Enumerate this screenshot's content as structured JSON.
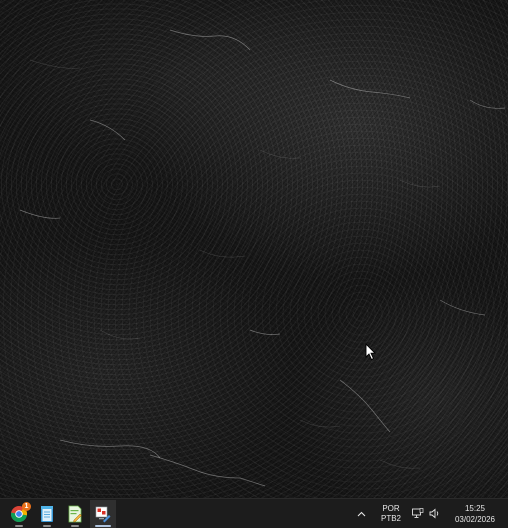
{
  "desktop": {
    "wallpaper": "dark-stone-texture",
    "cursor_icon": "arrow-cursor-icon"
  },
  "taskbar": {
    "apps": [
      {
        "icon": "chrome-icon",
        "badge": "1",
        "active": false
      },
      {
        "icon": "notepad-icon",
        "active": false
      },
      {
        "icon": "editor-document-icon",
        "active": false
      },
      {
        "icon": "paint-tool-icon",
        "active": true
      }
    ],
    "tray": {
      "chevron_icon": "chevron-up-icon",
      "language_line1": "POR",
      "language_line2": "PTB2",
      "network_icon": "network-icon",
      "volume_icon": "speaker-icon"
    },
    "clock": {
      "time": "15:25",
      "date": "03/02/2026"
    }
  },
  "colors": {
    "taskbar_bg": "#1c1c1c",
    "badge": "#e8711a",
    "active_indicator": "#b0c4de"
  }
}
